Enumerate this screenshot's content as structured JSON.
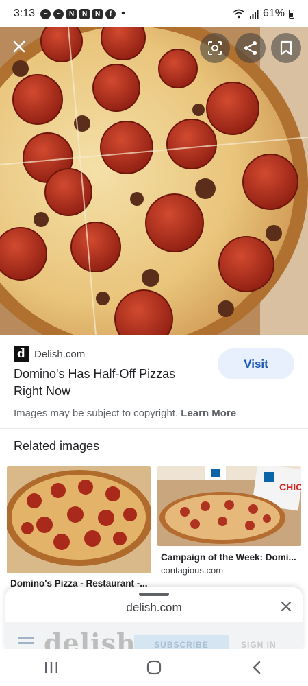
{
  "status_bar": {
    "time": "3:13",
    "notifications": [
      "messenger-icon",
      "messenger-icon",
      "netflix-icon",
      "netflix-icon",
      "netflix-icon",
      "facebook-icon"
    ],
    "more_dot": "•",
    "battery": "61%"
  },
  "hero": {
    "description": "pepperoni-and-sausage-pizza-photo"
  },
  "source": {
    "logo_letter": "d",
    "name": "Delish.com",
    "title": "Domino's Has Half-Off Pizzas Right Now",
    "visit_label": "Visit",
    "copyright_text": "Images may be subject to copyright.",
    "learn_more_label": "Learn More"
  },
  "related": {
    "heading": "Related images",
    "items": [
      {
        "caption": "Domino's Pizza - Restaurant -...",
        "source": ""
      },
      {
        "caption": "Campaign of the Week: Domi...",
        "source": "contagious.com"
      }
    ]
  },
  "sheet": {
    "url": "delish.com",
    "peek_logo": "delish",
    "peek_subscribe": "SUBSCRIBE",
    "peek_sign_in": "SIGN IN"
  },
  "colors": {
    "accent": "#1a56b5",
    "visit_bg": "#e8f0fe"
  }
}
